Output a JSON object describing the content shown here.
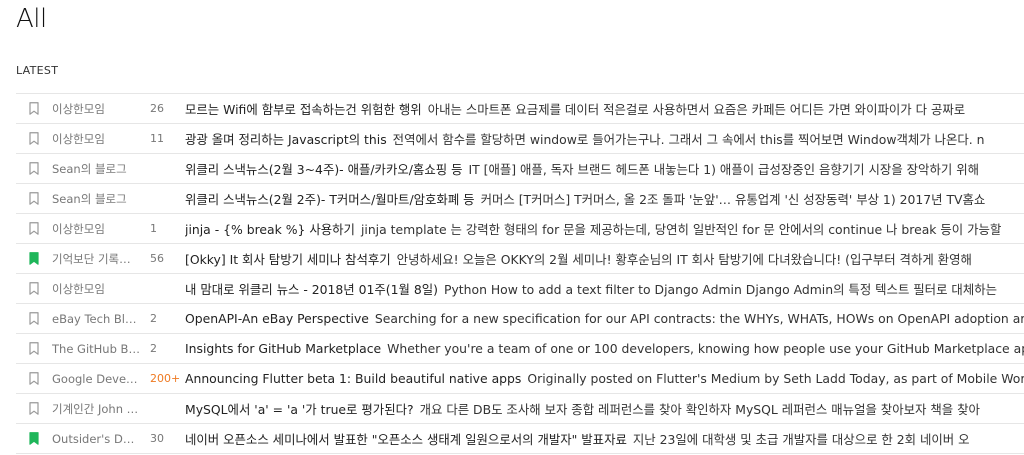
{
  "page": {
    "title": "All",
    "section_label": "LATEST"
  },
  "colors": {
    "bookmark_saved": "#1fb65a",
    "bookmark_outline": "#999999",
    "count_hot": "#ef7a22",
    "divider": "#e6e6e6"
  },
  "items": [
    {
      "source": "이상한모임",
      "count": "26",
      "title": "모르는 Wifi에 함부로 접속하는건 위험한 행위",
      "snippet": "아내는 스마트폰 요금제를 데이터 적은걸로 사용하면서 요즘은 카페든 어디든 가면 와이파이가 다 공짜로",
      "saved": false,
      "hot": false
    },
    {
      "source": "이상한모임",
      "count": "11",
      "title": "광광 올며 정리하는 Javascript의 this",
      "snippet": "전역에서 함수를 할당하면 window로 들어가는구나. 그래서 그 속에서 this를 찍어보면 Window객체가 나온다. n",
      "saved": false,
      "hot": false
    },
    {
      "source": "Sean의 블로그",
      "count": "",
      "title": "위클리 스낵뉴스(2월 3~4주)- 애플/카카오/홈쇼핑 등",
      "snippet": "IT [애플] 애플, 독자 브랜드 헤드폰 내놓는다 1) 애플이 급성장중인 음향기기 시장을 장악하기 위해",
      "saved": false,
      "hot": false
    },
    {
      "source": "Sean의 블로그",
      "count": "",
      "title": "위클리 스낵뉴스(2월 2주)- T커머스/월마트/암호화폐 등",
      "snippet": "커머스 [T커머스] T커머스, 올 2조 돌파 '눈앞'… 유통업계 '신 성장동력' 부상 1) 2017년 TV홈쇼",
      "saved": false,
      "hot": false
    },
    {
      "source": "이상한모임",
      "count": "1",
      "title": "jinja - {% break %} 사용하기",
      "snippet": "jinja template 는 강력한 형태의 for 문을 제공하는데, 당연히 일반적인 for 문 안에서의 continue 나 break 등이 가능할",
      "saved": false,
      "hot": false
    },
    {
      "source": "기억보단 기록…",
      "count": "56",
      "title": "[Okky] It 회사 탐방기 세미나 참석후기",
      "snippet": "안녕하세요! 오늘은 OKKY의 2월 세미나! 황후순님의 IT 회사 탐방기에 다녀왔습니다! (입구부터 격하게 환영해",
      "saved": true,
      "hot": false
    },
    {
      "source": "이상한모임",
      "count": "",
      "title": "내 맘대로 위클리 뉴스 - 2018년 01주(1월 8일)",
      "snippet": "Python How to add a text filter to Django Admin Django Admin의 특정 텍스트 필터로 대체하는",
      "saved": false,
      "hot": false
    },
    {
      "source": "eBay Tech Blo…",
      "count": "2",
      "title": "OpenAPI-An eBay Perspective",
      "snippet": "Searching for a new specification for our API contracts: the WHYs, WHATs, HOWs on OpenAPI adoption ar",
      "saved": false,
      "hot": false
    },
    {
      "source": "The GitHub Bl…",
      "count": "2",
      "title": "Insights for GitHub Marketplace",
      "snippet": "Whether you're a team of one or 100 developers, knowing how people use your GitHub Marketplace app",
      "saved": false,
      "hot": false
    },
    {
      "source": "Google Devel…",
      "count": "200+",
      "title": "Announcing Flutter beta 1: Build beautiful native apps",
      "snippet": "Originally posted on Flutter's Medium by Seth Ladd Today, as part of Mobile World",
      "saved": false,
      "hot": true
    },
    {
      "source": "기계인간 John …",
      "count": "",
      "title": "MySQL에서 'a' = 'a '가 true로 평가된다?",
      "snippet": "개요 다른 DB도 조사해 보자 종합 레퍼런스를 찾아 확인하자 MySQL 레퍼런스 매뉴얼을 찾아보자 책을 찾아",
      "saved": false,
      "hot": false
    },
    {
      "source": "Outsider's De…",
      "count": "30",
      "title": "네이버 오픈소스 세미나에서 발표한 \"오픈소스 생태계 일원으로서의 개발자\" 발표자료",
      "snippet": "지난 23일에 대학생 및 초급 개발자를 대상으로 한 2회 네이버 오",
      "saved": true,
      "hot": false
    }
  ]
}
